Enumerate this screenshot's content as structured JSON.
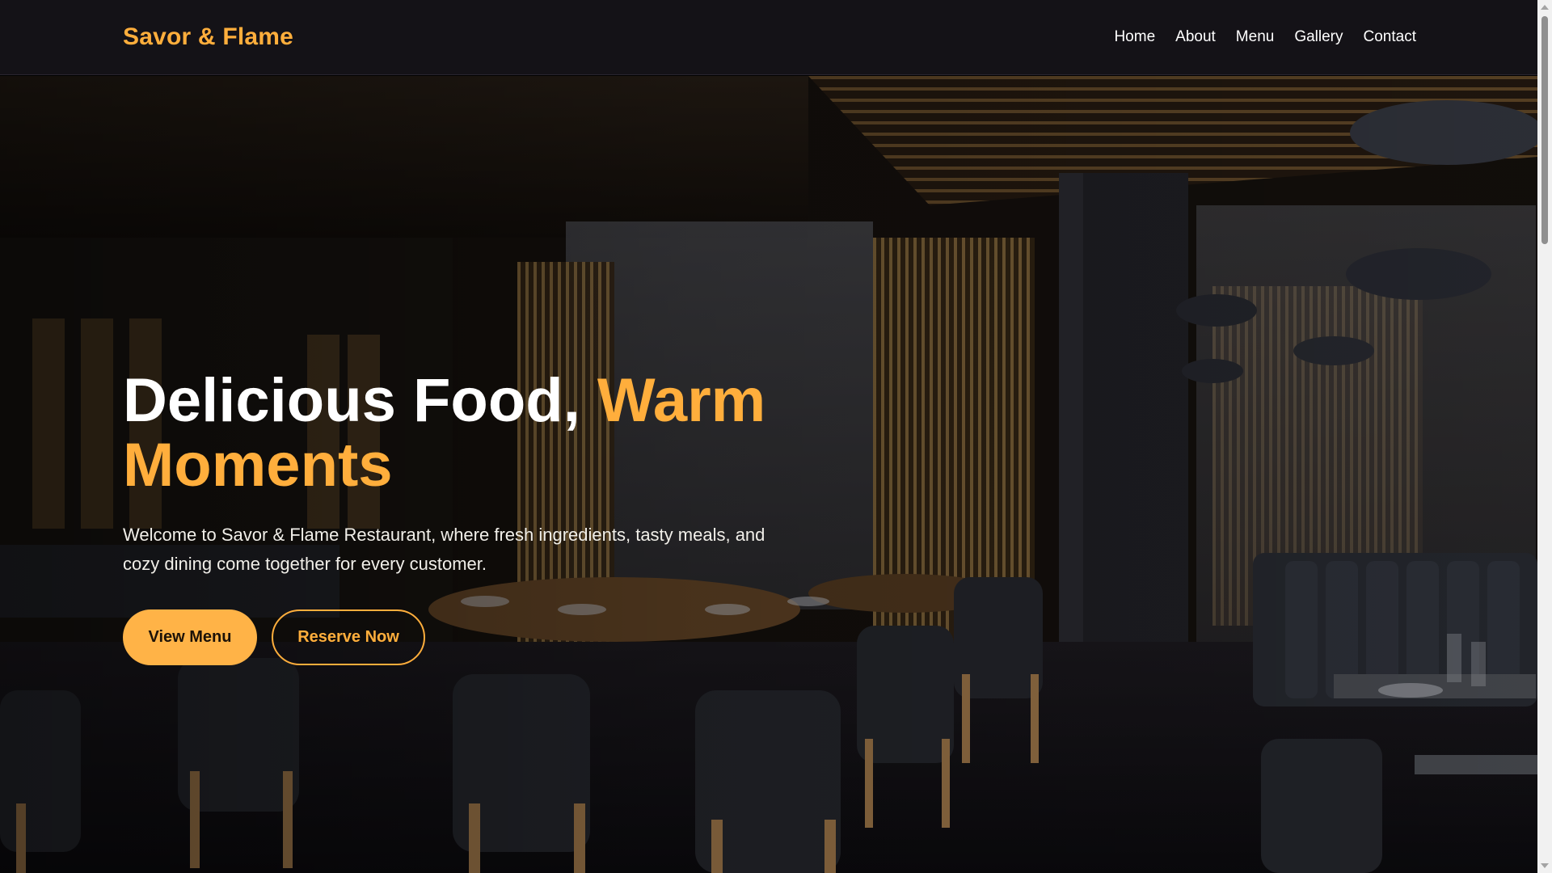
{
  "brand": {
    "name": "Savor & Flame"
  },
  "nav": {
    "items": [
      {
        "label": "Home"
      },
      {
        "label": "About"
      },
      {
        "label": "Menu"
      },
      {
        "label": "Gallery"
      },
      {
        "label": "Contact"
      }
    ]
  },
  "hero": {
    "title_main": "Delicious Food, ",
    "title_accent": "Warm Moments",
    "description": "Welcome to Savor & Flame Restaurant, where fresh ingredients, tasty meals, and cozy dining come together for every customer.",
    "primary_button": "View Menu",
    "secondary_button": "Reserve Now"
  },
  "colors": {
    "accent": "#ffae3c",
    "navbar_bg": "#141217",
    "text": "#ffffff"
  }
}
